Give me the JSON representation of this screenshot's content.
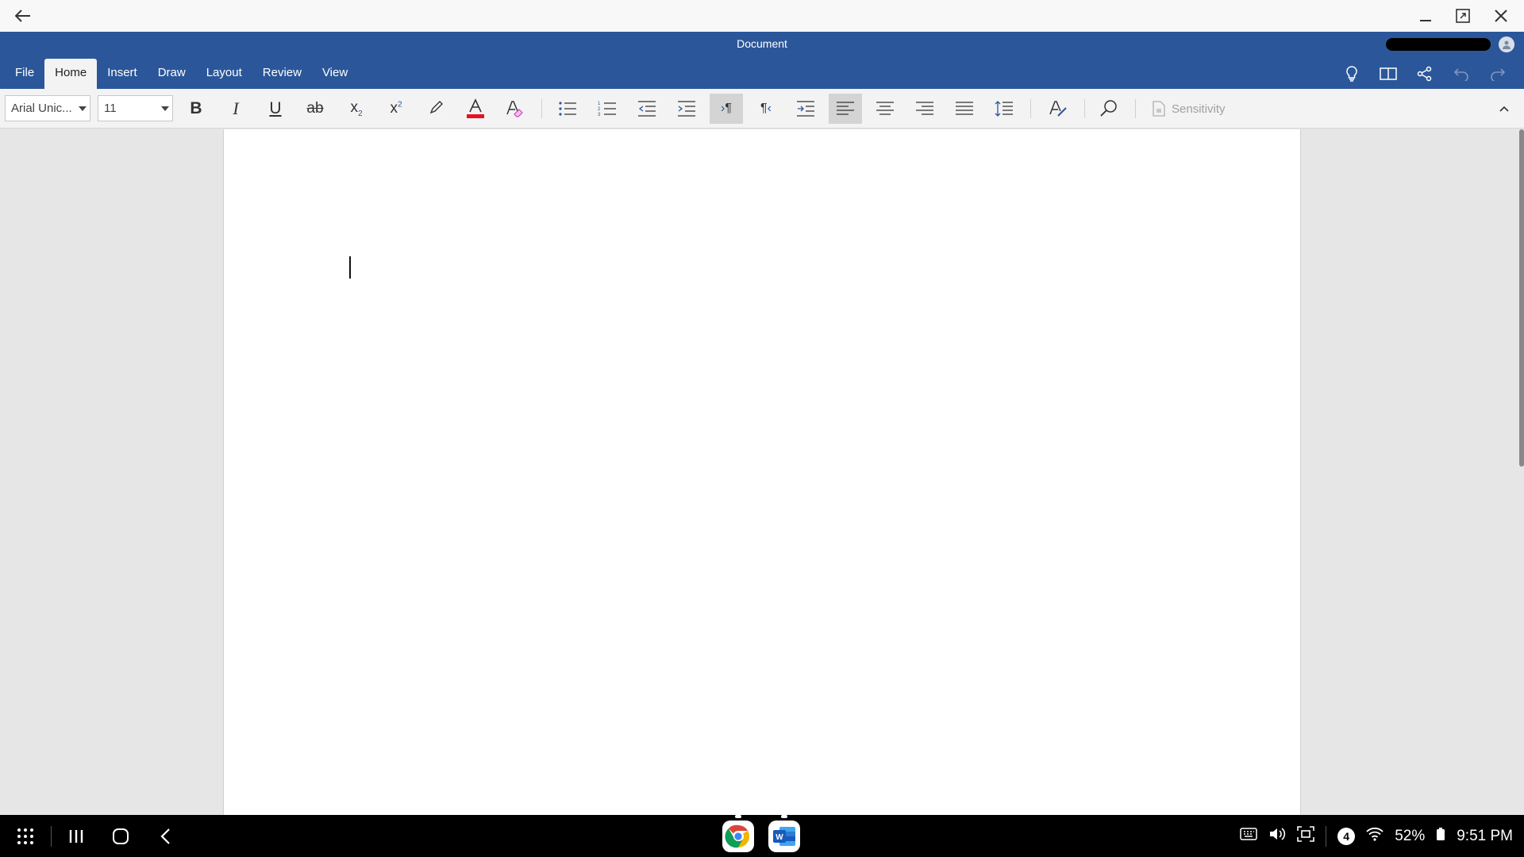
{
  "window": {
    "title": "Document"
  },
  "tabs": [
    "File",
    "Home",
    "Insert",
    "Draw",
    "Layout",
    "Review",
    "View"
  ],
  "active_tab": "Home",
  "ribbon": {
    "font_name": "Arial Unic...",
    "font_size": "11",
    "sensitivity_label": "Sensitivity"
  },
  "colors": {
    "brand": "#2b579a",
    "font_color_bar": "#e81123"
  },
  "status": {
    "notification_count": "4",
    "battery": "52%",
    "time": "9:51 PM"
  }
}
